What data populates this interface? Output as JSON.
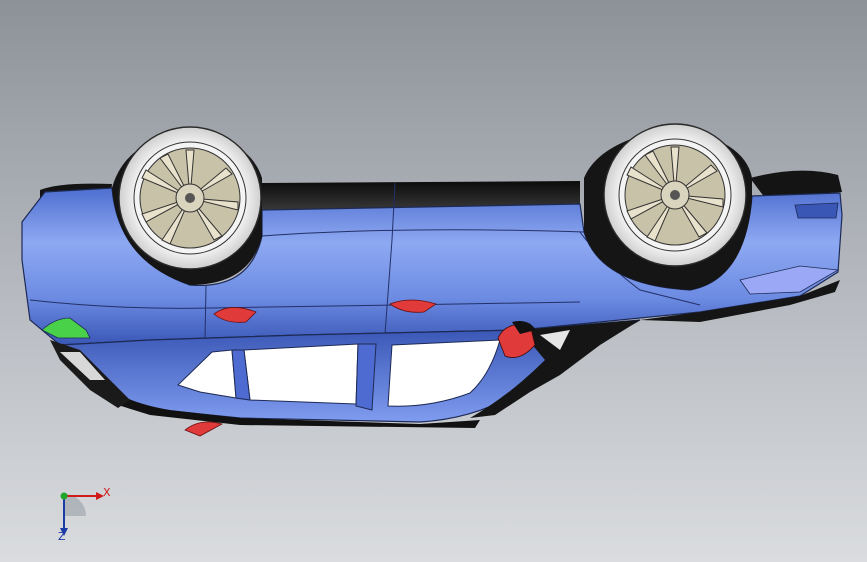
{
  "viewport": {
    "background_top": "#8d9299",
    "background_bottom": "#dadcdf"
  },
  "model": {
    "icon": "car-model-upside-down",
    "body_color": "#6f8fe0",
    "trim_color": "#1d1d1d",
    "accent_color": "#e03a3a",
    "glass_color": "#ffffff"
  },
  "triad": {
    "x_label": "X",
    "z_label": "Z",
    "x_color": "#d11a1a",
    "y_color": "#1ea52a",
    "z_color": "#1b3aa5"
  }
}
